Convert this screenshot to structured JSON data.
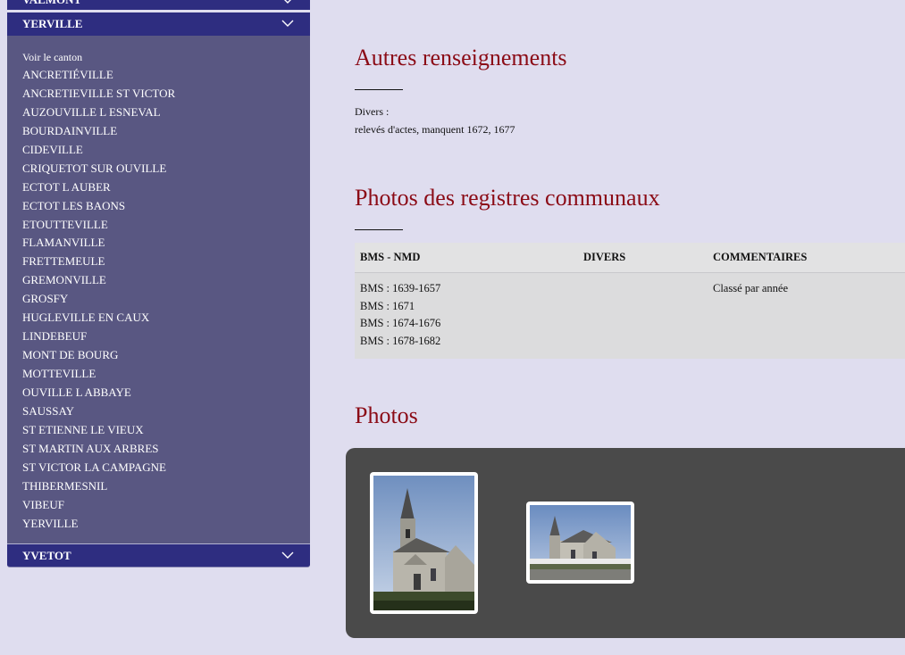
{
  "sidebar": {
    "prev_section": "VALMONT",
    "current_section": {
      "title": "YERVILLE",
      "items": [
        "Voir le canton",
        "ANCRETIÉVILLE",
        "ANCRETIEVILLE ST VICTOR",
        "AUZOUVILLE L ESNEVAL",
        "BOURDAINVILLE",
        "CIDEVILLE",
        "CRIQUETOT SUR OUVILLE",
        "ECTOT L AUBER",
        "ECTOT LES BAONS",
        "ETOUTTEVILLE",
        "FLAMANVILLE",
        "FRETTEMEULE",
        "GREMONVILLE",
        "GROSFY",
        "HUGLEVILLE EN CAUX",
        "LINDEBEUF",
        "MONT DE BOURG",
        "MOTTEVILLE",
        "OUVILLE L ABBAYE",
        "SAUSSAY",
        "ST ETIENNE LE VIEUX",
        "ST MARTIN AUX ARBRES",
        "ST VICTOR LA CAMPAGNE",
        "THIBERMESNIL",
        "VIBEUF",
        "YERVILLE"
      ]
    },
    "next_section": "YVETOT"
  },
  "main": {
    "other_info": {
      "title": "Autres renseignements",
      "label": "Divers :",
      "text": "relevés d'actes, manquent 1672, 1677"
    },
    "registers": {
      "title": "Photos des registres communaux",
      "columns": [
        "BMS - NMD",
        "DIVERS",
        "COMMENTAIRES"
      ],
      "bms_nmd": [
        "BMS : 1639-1657",
        "BMS : 1671",
        "BMS : 1674-1676",
        "BMS : 1678-1682"
      ],
      "divers": "",
      "commentaires": "Classé par année"
    },
    "photos": {
      "title": "Photos",
      "thumbnails": [
        "church-photo-portrait",
        "church-photo-landscape"
      ]
    }
  },
  "colors": {
    "page_bg": "#dfddef",
    "accordion_header": "#2e2d80",
    "accordion_body": "#595782",
    "heading": "#8b0b16",
    "gallery_bg": "#4a4a4a"
  }
}
